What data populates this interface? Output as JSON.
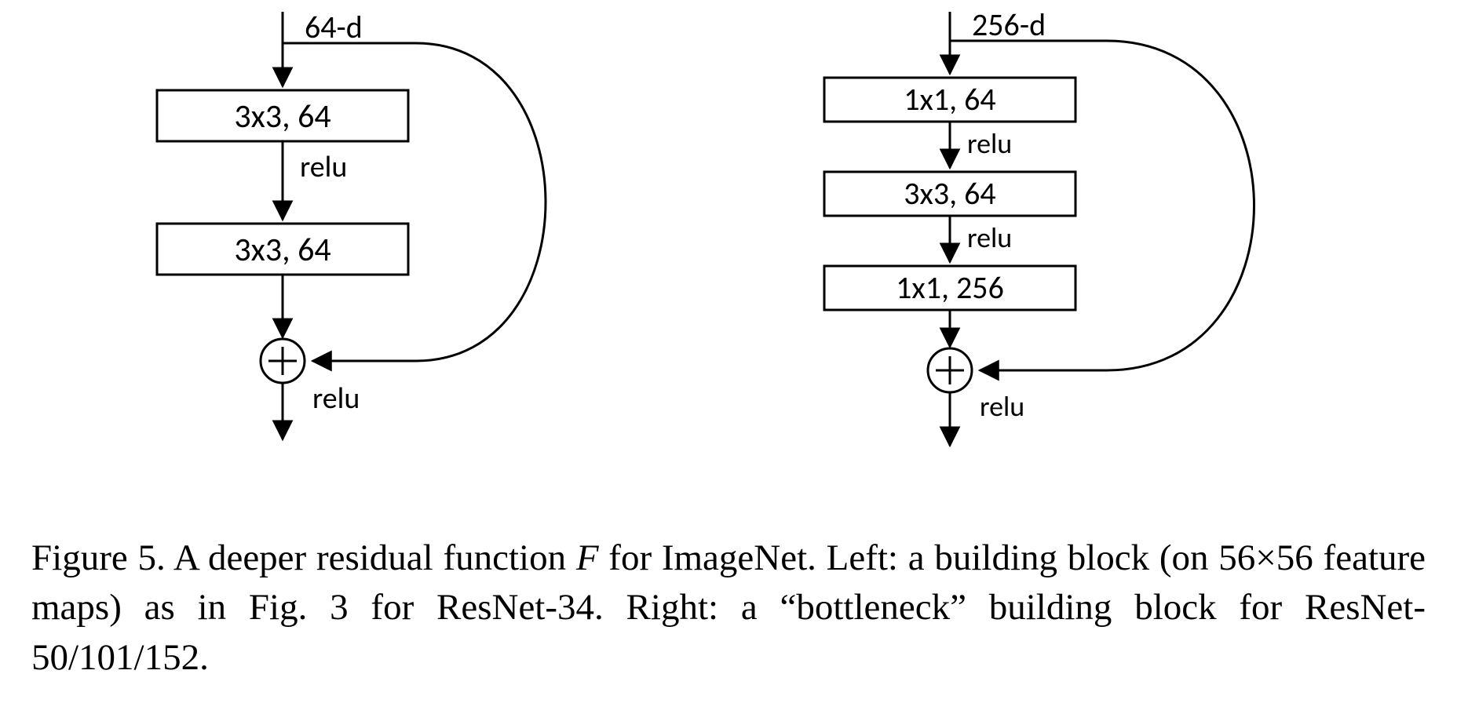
{
  "left_block": {
    "input_label": "64-d",
    "layers": [
      "3x3, 64",
      "3x3, 64"
    ],
    "activations": [
      "relu",
      "relu"
    ]
  },
  "right_block": {
    "input_label": "256-d",
    "layers": [
      "1x1, 64",
      "3x3, 64",
      "1x1, 256"
    ],
    "activations": [
      "relu",
      "relu",
      "relu"
    ]
  },
  "caption": {
    "fig_label": "Figure 5.",
    "pre": " A deeper residual function ",
    "scriptF": "F",
    "post1": " for ImageNet.  Left: a building block (on 56×56 feature maps) as in Fig. 3 for ResNet-34. Right: a “bottleneck” building block for ResNet-50/101/152."
  }
}
